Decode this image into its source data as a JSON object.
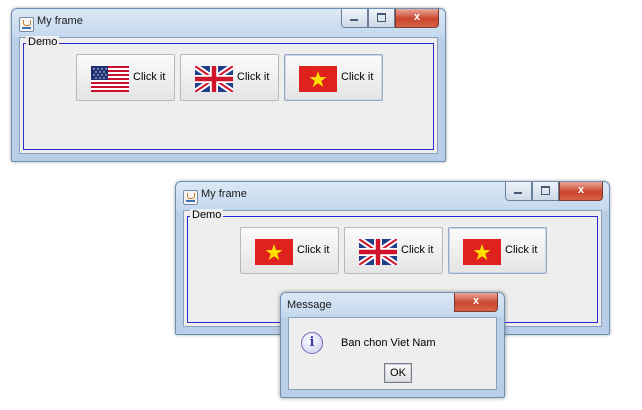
{
  "windows": [
    {
      "title": "My frame",
      "group_label": "Demo",
      "close_glyph": "x",
      "buttons": [
        {
          "label": "Click it",
          "flag": "flag-usa"
        },
        {
          "label": "Click it",
          "flag": "flag-uk"
        },
        {
          "label": "Click it",
          "flag": "flag-vietnam"
        }
      ]
    },
    {
      "title": "My frame",
      "group_label": "Demo",
      "close_glyph": "x",
      "buttons": [
        {
          "label": "Click it",
          "flag": "flag-vietnam"
        },
        {
          "label": "Click it",
          "flag": "flag-uk"
        },
        {
          "label": "Click it",
          "flag": "flag-vietnam"
        }
      ]
    }
  ],
  "dialog": {
    "title": "Message",
    "close_glyph": "x",
    "icon": "info-icon",
    "icon_glyph": "i",
    "message": "Ban chon Viet Nam",
    "ok_label": "OK"
  },
  "colors": {
    "group_border": "#2b2bd0",
    "close_button": "#c8462d",
    "titlebar": "#c4d8ee"
  }
}
